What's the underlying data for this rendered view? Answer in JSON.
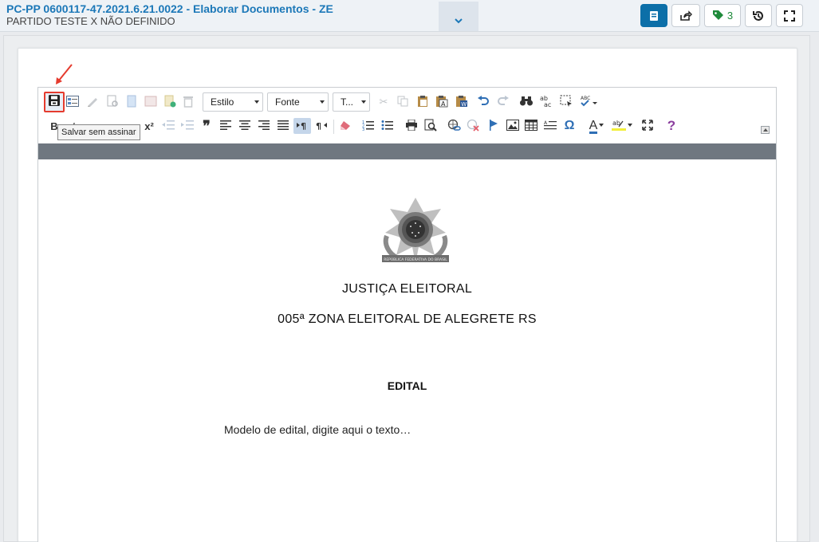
{
  "header": {
    "title": "PC-PP 0600117-47.2021.6.21.0022 - Elaborar Documentos - ZE",
    "subtitle": "PARTIDO TESTE X NÃO DEFINIDO",
    "tag_count": "3",
    "buttons": {
      "document": "document-icon",
      "share": "share-icon",
      "tags": "tag-icon",
      "history": "history-icon",
      "fullscreen": "fullscreen-icon"
    }
  },
  "toolbar": {
    "style_label": "Estilo",
    "font_label": "Fonte",
    "size_label": "T...",
    "tooltip": "Salvar sem assinar",
    "bold": "B",
    "italic": "I",
    "superscript": "x²",
    "quote": "❞",
    "omega": "Ω",
    "help": "?",
    "font_color": "A",
    "spell_label": "ABC"
  },
  "document": {
    "heading1": "JUSTIÇA ELEITORAL",
    "heading2": "005ª ZONA ELEITORAL DE ALEGRETE RS",
    "section_title": "EDITAL",
    "body": "Modelo de edital, digite aqui o texto…",
    "emblem_label": "REPÚBLICA FEDERATIVA DO BRASIL"
  },
  "colors": {
    "accent": "#1c78b8",
    "primary_button": "#0c6fa8",
    "highlight": "#e53b2e",
    "tag_green": "#1e8a3a",
    "ruler": "#6f7780"
  }
}
